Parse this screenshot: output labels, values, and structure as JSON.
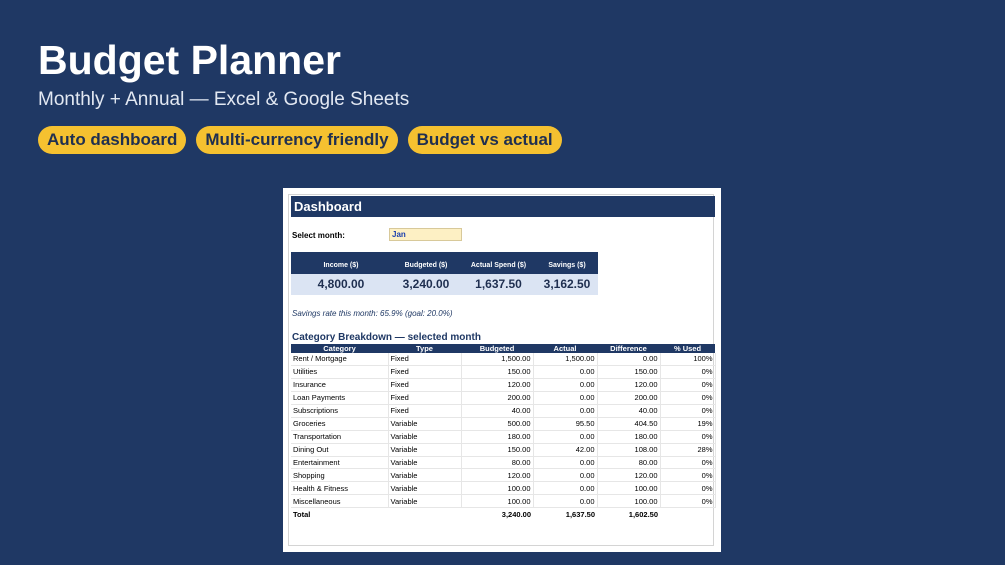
{
  "header": {
    "title": "Budget Planner",
    "subtitle": "Monthly + Annual — Excel & Google Sheets"
  },
  "badges": [
    "Auto dashboard",
    "Multi-currency friendly",
    "Budget vs actual"
  ],
  "colors": {
    "background": "#1f3864",
    "badge": "#f5c130",
    "sheet_header": "#1f3864",
    "kpi_value_bg": "#dbe4f3",
    "select_bg": "#fdf0c4"
  },
  "dashboard": {
    "title": "Dashboard",
    "select_label": "Select month:",
    "select_value": "Jan",
    "kpis": [
      {
        "label": "Income ($)",
        "value": "4,800.00"
      },
      {
        "label": "Budgeted ($)",
        "value": "3,240.00"
      },
      {
        "label": "Actual Spend ($)",
        "value": "1,637.50"
      },
      {
        "label": "Savings ($)",
        "value": "3,162.50"
      }
    ],
    "savings_rate": "Savings rate this month: 65.9%   (goal: 20.0%)",
    "breakdown": {
      "title": "Category Breakdown — selected month",
      "columns": [
        "Category",
        "Type",
        "Budgeted",
        "Actual",
        "Difference",
        "% Used"
      ],
      "rows": [
        [
          "Rent / Mortgage",
          "Fixed",
          "1,500.00",
          "1,500.00",
          "0.00",
          "100%"
        ],
        [
          "Utilities",
          "Fixed",
          "150.00",
          "0.00",
          "150.00",
          "0%"
        ],
        [
          "Insurance",
          "Fixed",
          "120.00",
          "0.00",
          "120.00",
          "0%"
        ],
        [
          "Loan Payments",
          "Fixed",
          "200.00",
          "0.00",
          "200.00",
          "0%"
        ],
        [
          "Subscriptions",
          "Fixed",
          "40.00",
          "0.00",
          "40.00",
          "0%"
        ],
        [
          "Groceries",
          "Variable",
          "500.00",
          "95.50",
          "404.50",
          "19%"
        ],
        [
          "Transportation",
          "Variable",
          "180.00",
          "0.00",
          "180.00",
          "0%"
        ],
        [
          "Dining Out",
          "Variable",
          "150.00",
          "42.00",
          "108.00",
          "28%"
        ],
        [
          "Entertainment",
          "Variable",
          "80.00",
          "0.00",
          "80.00",
          "0%"
        ],
        [
          "Shopping",
          "Variable",
          "120.00",
          "0.00",
          "120.00",
          "0%"
        ],
        [
          "Health & Fitness",
          "Variable",
          "100.00",
          "0.00",
          "100.00",
          "0%"
        ],
        [
          "Miscellaneous",
          "Variable",
          "100.00",
          "0.00",
          "100.00",
          "0%"
        ]
      ],
      "total": [
        "Total",
        "",
        "3,240.00",
        "1,637.50",
        "1,602.50",
        ""
      ]
    }
  }
}
